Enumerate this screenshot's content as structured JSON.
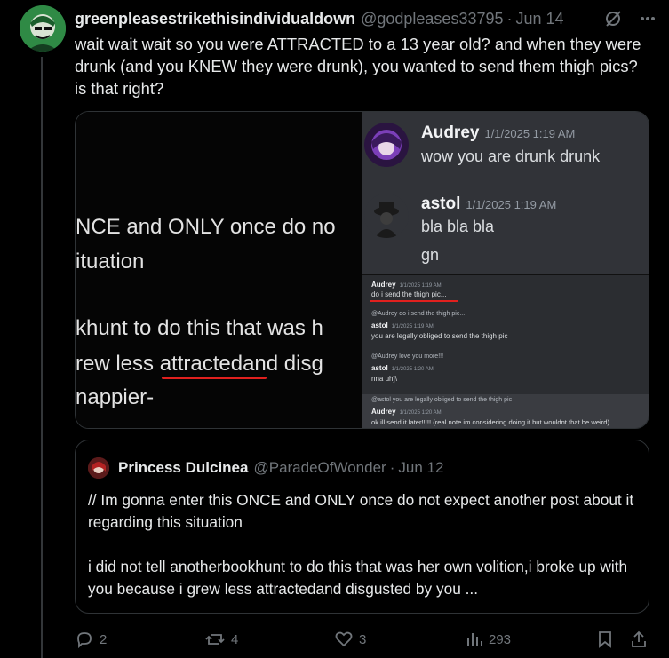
{
  "post": {
    "display_name": "greenpleasestrikethisindividualdown",
    "handle": "@godpleases33795",
    "separator": "·",
    "date": "Jun 14",
    "text": "wait wait wait so you were ATTRACTED to a 13 year old? and when they were drunk (and you KNEW they were drunk), you wanted to send them thigh pics? is that right?"
  },
  "media": {
    "left_lines": [
      "NCE and ONLY once do no",
      "ituation",
      "khunt to do this that was h",
      "rew less attractedand disg",
      "nappier-"
    ],
    "discord_top": [
      {
        "name": "Audrey",
        "time": "1/1/2025 1:19 AM",
        "messages": [
          "wow you are drunk drunk"
        ]
      },
      {
        "name": "astol",
        "time": "1/1/2025 1:19 AM",
        "messages": [
          "bla bla bla",
          "gn"
        ]
      }
    ],
    "discord_bottom": {
      "m1": {
        "name": "Audrey",
        "time": "1/1/2025 1:19 AM",
        "text": "do i send the thigh pic..."
      },
      "r1": "@Audrey do i send the thigh pic...",
      "m2": {
        "name": "astol",
        "time": "1/1/2025 1:19 AM",
        "text": "you are legally obliged to send the thigh pic"
      },
      "r2": "@Audrey love you more!!!",
      "m3": {
        "name": "astol",
        "time": "1/1/2025 1:20 AM",
        "text": "nna uh]\\"
      },
      "r3": "@astol you are legally obliged to send the thigh pic",
      "m4": {
        "name": "Audrey",
        "time": "1/1/2025 1:20 AM",
        "text": "ok ill send it later!!!!! (real note im considering doing it but wouldnt that be weird)"
      }
    }
  },
  "quote": {
    "display_name": "Princess Dulcinea",
    "handle": "@ParadeOfWonder",
    "separator": "·",
    "date": "Jun 12",
    "para1": "// Im gonna enter this ONCE and ONLY once do not expect another post about it regarding this situation",
    "para2": "i did not tell anotherbookhunt to do this that was her own volition,i broke up with you because i grew less attractedand disgusted by you ..."
  },
  "actions": {
    "replies": "2",
    "reposts": "4",
    "likes": "3",
    "views": "293"
  },
  "colors": {
    "background": "#000000",
    "text": "#e7e9ea",
    "muted": "#71767b",
    "border": "#2f3336",
    "discord_bg": "#313338",
    "underline_red": "#e0201e"
  },
  "icons": [
    "grok-icon",
    "more-icon",
    "reply-icon",
    "repost-icon",
    "like-icon",
    "views-icon",
    "bookmark-icon",
    "share-icon"
  ]
}
